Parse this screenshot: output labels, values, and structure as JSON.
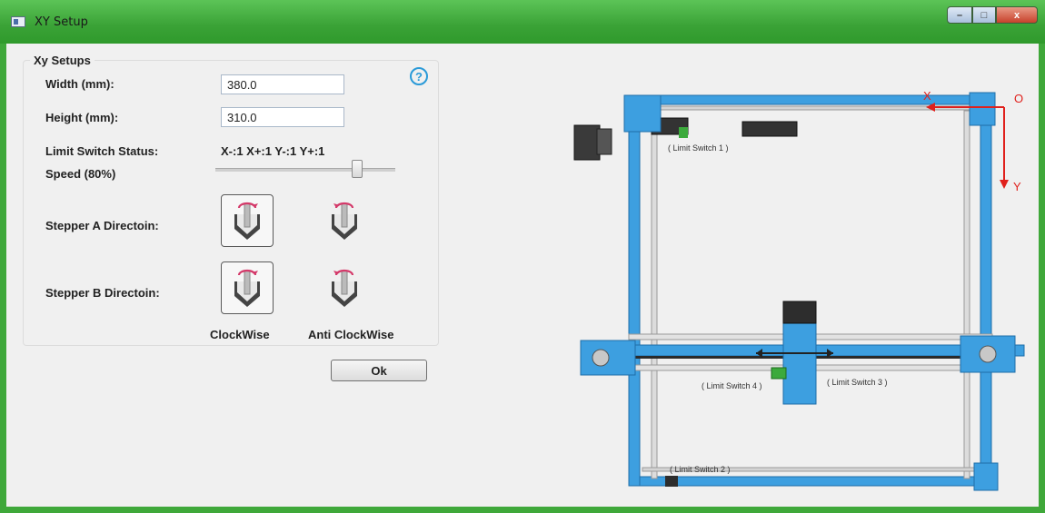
{
  "window": {
    "title": "XY Setup",
    "close_label": "x"
  },
  "group": {
    "title": "Xy Setups",
    "width_label": "Width (mm):",
    "width_value": "380.0",
    "height_label": "Height (mm):",
    "height_value": "310.0",
    "limit_label": "Limit Switch Status:",
    "limit_value": "X-:1 X+:1 Y-:1 Y+:1",
    "speed_label": "Speed (80%)",
    "speed_value": 0.8,
    "stepper_a_label": "Stepper A Directoin:",
    "stepper_b_label": "Stepper B Directoin:",
    "clockwise_label": "ClockWise",
    "anticlockwise_label": "Anti ClockWise",
    "help_glyph": "?"
  },
  "ok_label": "Ok",
  "diagram": {
    "axis_x": "X",
    "axis_y": "Y",
    "origin": "O",
    "limit1": "( Limit Switch 1 )",
    "limit2": "( Limit Switch 2 )",
    "limit3": "( Limit Switch 3 )",
    "limit4": "( Limit Switch 4 )"
  },
  "colors": {
    "frame_blue": "#3d9fe0",
    "title_green": "#3fa83a",
    "arrow_red": "#e0201c",
    "help_blue": "#2a9ad8"
  }
}
